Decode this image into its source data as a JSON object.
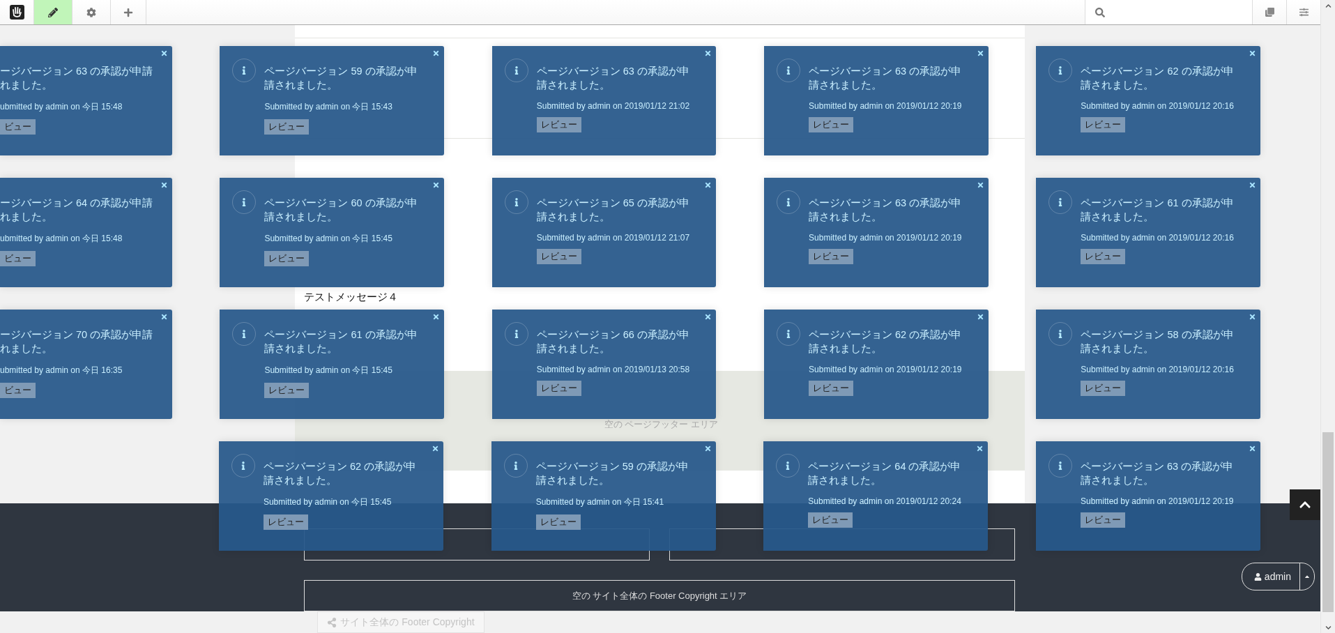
{
  "toolbar": {
    "buttons": [
      {
        "kind": "logo",
        "selected": false
      },
      {
        "kind": "edit",
        "selected": true
      },
      {
        "kind": "settings",
        "selected": false
      },
      {
        "kind": "add",
        "selected": false
      }
    ],
    "right_buttons": [
      {
        "kind": "pages"
      },
      {
        "kind": "options"
      }
    ]
  },
  "page": {
    "messages": [
      "テストメッセージ４"
    ],
    "page_footer": "空の ページフッター エリア",
    "footer_copyright_area": "空の サイト全体の Footer Copyright エリア",
    "copyright_tab": "サイト全体の Footer Copyright"
  },
  "notifications": [
    {
      "cards": [
        {
          "kind": "clipped",
          "lines": [
            "ージバージョン 63 の承認が申請",
            "れました。"
          ],
          "meta": "ubmitted by admin on 今日 15:48",
          "button": "ビュー"
        },
        {
          "kind": "full",
          "message": "ページバージョン 59 の承認が申請されました。",
          "meta": "Submitted by admin on 今日 15:43",
          "button": "レビュー"
        },
        {
          "kind": "full",
          "message": "ページバージョン 63 の承認が申請されました。",
          "meta": "Submitted by admin on 2019/01/12 21:02",
          "button": "レビュー"
        },
        {
          "kind": "full",
          "message": "ページバージョン 63 の承認が申請されました。",
          "meta": "Submitted by admin on 2019/01/12 20:19",
          "button": "レビュー"
        },
        {
          "kind": "full",
          "message": "ページバージョン 62 の承認が申請されました。",
          "meta": "Submitted by admin on 2019/01/12 20:16",
          "button": "レビュー"
        }
      ]
    },
    {
      "cards": [
        {
          "kind": "clipped",
          "lines": [
            "ージバージョン 64 の承認が申請",
            "れました。"
          ],
          "meta": "ubmitted by admin on 今日 15:48",
          "button": "ビュー"
        },
        {
          "kind": "full",
          "message": "ページバージョン 60 の承認が申請されました。",
          "meta": "Submitted by admin on 今日 15:45",
          "button": "レビュー"
        },
        {
          "kind": "full",
          "message": "ページバージョン 65 の承認が申請されました。",
          "meta": "Submitted by admin on 2019/01/12 21:07",
          "button": "レビュー"
        },
        {
          "kind": "full",
          "message": "ページバージョン 63 の承認が申請されました。",
          "meta": "Submitted by admin on 2019/01/12 20:19",
          "button": "レビュー"
        },
        {
          "kind": "full",
          "message": "ページバージョン 61 の承認が申請されました。",
          "meta": "Submitted by admin on 2019/01/12 20:16",
          "button": "レビュー"
        }
      ]
    },
    {
      "cards": [
        {
          "kind": "clipped",
          "lines": [
            "ージバージョン 70 の承認が申請",
            "れました。"
          ],
          "meta": "ubmitted by admin on 今日 16:35",
          "button": "ビュー"
        },
        {
          "kind": "full",
          "message": "ページバージョン 61 の承認が申請されました。",
          "meta": "Submitted by admin on 今日 15:45",
          "button": "レビュー"
        },
        {
          "kind": "full",
          "message": "ページバージョン 66 の承認が申請されました。",
          "meta": "Submitted by admin on 2019/01/13 20:58",
          "button": "レビュー"
        },
        {
          "kind": "full",
          "message": "ページバージョン 62 の承認が申請されました。",
          "meta": "Submitted by admin on 2019/01/12 20:19",
          "button": "レビュー"
        },
        {
          "kind": "full",
          "message": "ページバージョン 58 の承認が申請されました。",
          "meta": "Submitted by admin on 2019/01/12 20:16",
          "button": "レビュー"
        }
      ]
    },
    {
      "cards": [
        {
          "kind": "full",
          "message": "ページバージョン 62 の承認が申請されました。",
          "meta": "Submitted by admin on 今日 15:45",
          "button": "レビュー"
        },
        {
          "kind": "full",
          "message": "ページバージョン 59 の承認が申請されました。",
          "meta": "Submitted by admin on 今日 15:41",
          "button": "レビュー"
        },
        {
          "kind": "full",
          "message": "ページバージョン 64 の承認が申請されました。",
          "meta": "Submitted by admin on 2019/01/12 20:24",
          "button": "レビュー"
        },
        {
          "kind": "full",
          "message": "ページバージョン 63 の承認が申請されました。",
          "meta": "Submitted by admin on 2019/01/12 20:19",
          "button": "レビュー"
        }
      ]
    }
  ],
  "user_menu": {
    "label": "admin"
  }
}
